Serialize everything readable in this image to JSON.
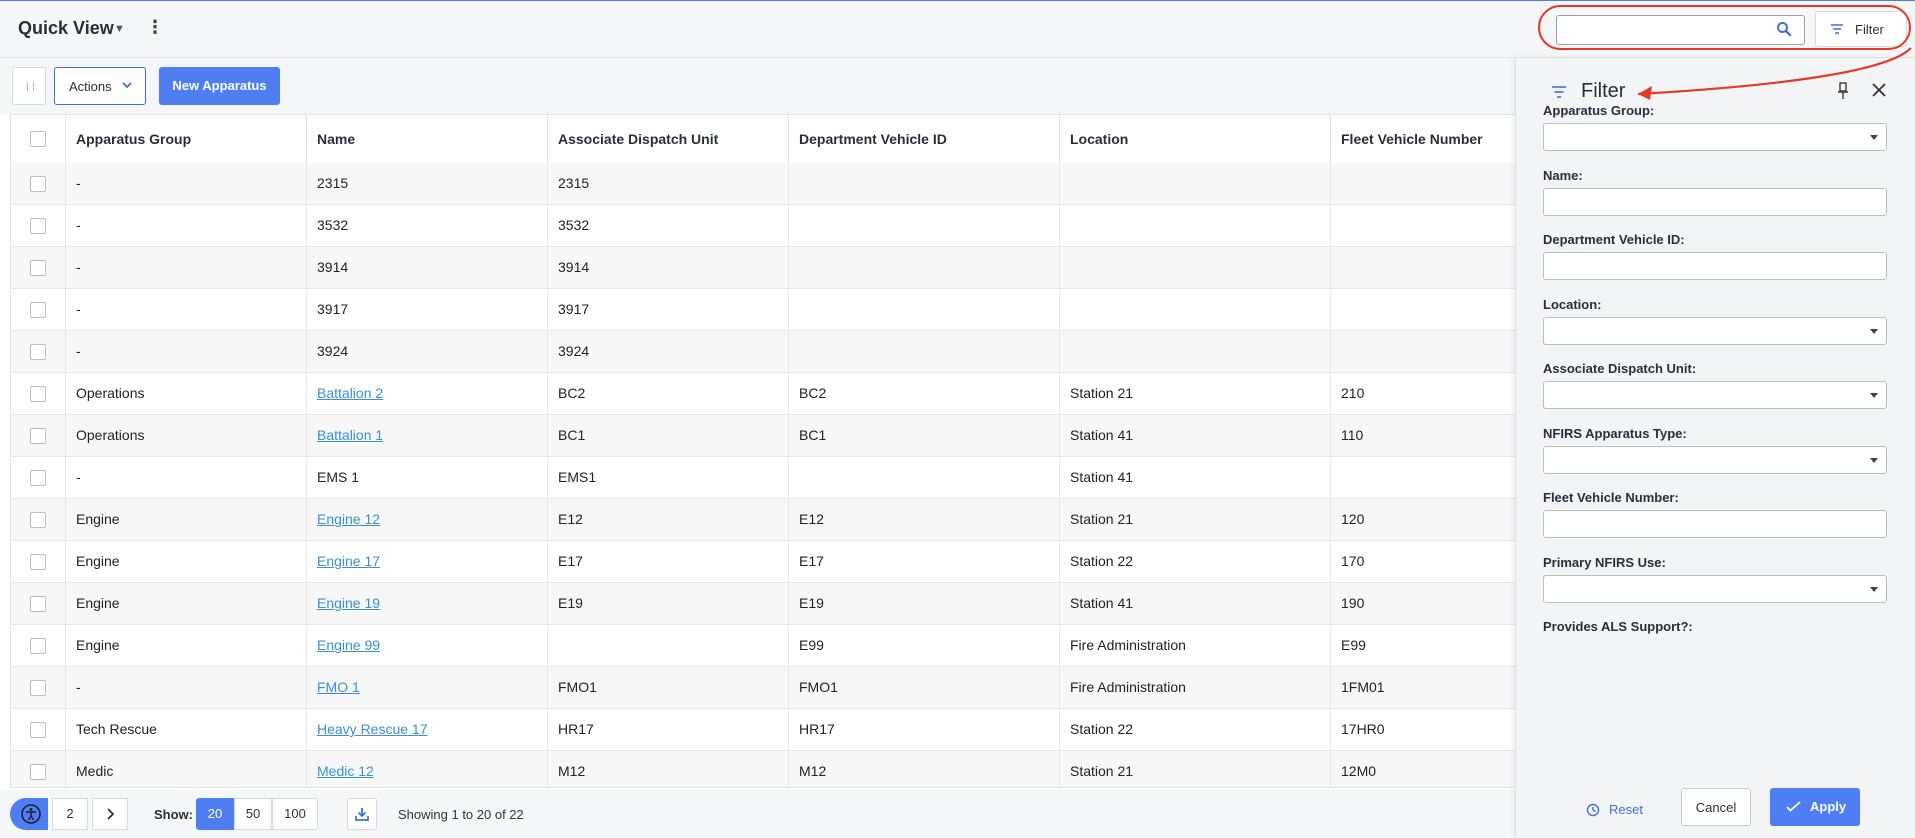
{
  "header": {
    "title": "Quick View",
    "kebab": "⋮",
    "search_value": "",
    "filter_label": "Filter"
  },
  "toolbar": {
    "actions_label": "Actions",
    "new_label": "New Apparatus"
  },
  "table": {
    "columns": [
      "Apparatus Group",
      "Name",
      "Associate Dispatch Unit",
      "Department Vehicle ID",
      "Location",
      "Fleet Vehicle Number"
    ],
    "rows": [
      {
        "group": "-",
        "name": "2315",
        "name_link": false,
        "unit": "2315",
        "vehicle_id": "",
        "location": "",
        "fleet": ""
      },
      {
        "group": "-",
        "name": "3532",
        "name_link": false,
        "unit": "3532",
        "vehicle_id": "",
        "location": "",
        "fleet": ""
      },
      {
        "group": "-",
        "name": "3914",
        "name_link": false,
        "unit": "3914",
        "vehicle_id": "",
        "location": "",
        "fleet": ""
      },
      {
        "group": "-",
        "name": "3917",
        "name_link": false,
        "unit": "3917",
        "vehicle_id": "",
        "location": "",
        "fleet": ""
      },
      {
        "group": "-",
        "name": "3924",
        "name_link": false,
        "unit": "3924",
        "vehicle_id": "",
        "location": "",
        "fleet": ""
      },
      {
        "group": "Operations",
        "name": "Battalion 2",
        "name_link": true,
        "unit": "BC2",
        "vehicle_id": "BC2",
        "location": "Station 21",
        "fleet": "210"
      },
      {
        "group": "Operations",
        "name": "Battalion 1",
        "name_link": true,
        "unit": "BC1",
        "vehicle_id": "BC1",
        "location": "Station 41",
        "fleet": "110"
      },
      {
        "group": "-",
        "name": "EMS 1",
        "name_link": false,
        "unit": "EMS1",
        "vehicle_id": "",
        "location": "Station 41",
        "fleet": ""
      },
      {
        "group": "Engine",
        "name": "Engine 12",
        "name_link": true,
        "unit": "E12",
        "vehicle_id": "E12",
        "location": "Station 21",
        "fleet": "120"
      },
      {
        "group": "Engine",
        "name": "Engine 17",
        "name_link": true,
        "unit": "E17",
        "vehicle_id": "E17",
        "location": "Station 22",
        "fleet": "170"
      },
      {
        "group": "Engine",
        "name": "Engine 19",
        "name_link": true,
        "unit": "E19",
        "vehicle_id": "E19",
        "location": "Station 41",
        "fleet": "190"
      },
      {
        "group": "Engine",
        "name": "Engine 99",
        "name_link": true,
        "unit": "",
        "vehicle_id": "E99",
        "location": "Fire Administration",
        "fleet": "E99"
      },
      {
        "group": "-",
        "name": "FMO 1",
        "name_link": true,
        "unit": "FMO1",
        "vehicle_id": "FMO1",
        "location": "Fire Administration",
        "fleet": "1FM01"
      },
      {
        "group": "Tech Rescue",
        "name": "Heavy Rescue 17",
        "name_link": true,
        "unit": "HR17",
        "vehicle_id": "HR17",
        "location": "Station 22",
        "fleet": "17HR0"
      },
      {
        "group": "Medic",
        "name": "Medic 12",
        "name_link": true,
        "unit": "M12",
        "vehicle_id": "M12",
        "location": "Station 21",
        "fleet": "12M0"
      }
    ]
  },
  "footer": {
    "page_next": "2",
    "show_label": "Show:",
    "sizes": [
      "20",
      "50",
      "100"
    ],
    "active_size": "20",
    "showing_text": "Showing 1 to 20 of 22"
  },
  "filter_panel": {
    "title": "Filter",
    "fields": [
      {
        "label": "Apparatus Group:",
        "type": "select"
      },
      {
        "label": "Name:",
        "type": "text"
      },
      {
        "label": "Department Vehicle ID:",
        "type": "text"
      },
      {
        "label": "Location:",
        "type": "select"
      },
      {
        "label": "Associate Dispatch Unit:",
        "type": "select"
      },
      {
        "label": "NFIRS Apparatus Type:",
        "type": "select"
      },
      {
        "label": "Fleet Vehicle Number:",
        "type": "text"
      },
      {
        "label": "Primary NFIRS Use:",
        "type": "select"
      },
      {
        "label": "Provides ALS Support?:",
        "type": "none"
      }
    ],
    "reset_label": "Reset",
    "cancel_label": "Cancel",
    "apply_label": "Apply"
  },
  "colors": {
    "accent": "#4e7ef2",
    "link": "#3a8fd6",
    "annotation": "#e23a2a"
  }
}
